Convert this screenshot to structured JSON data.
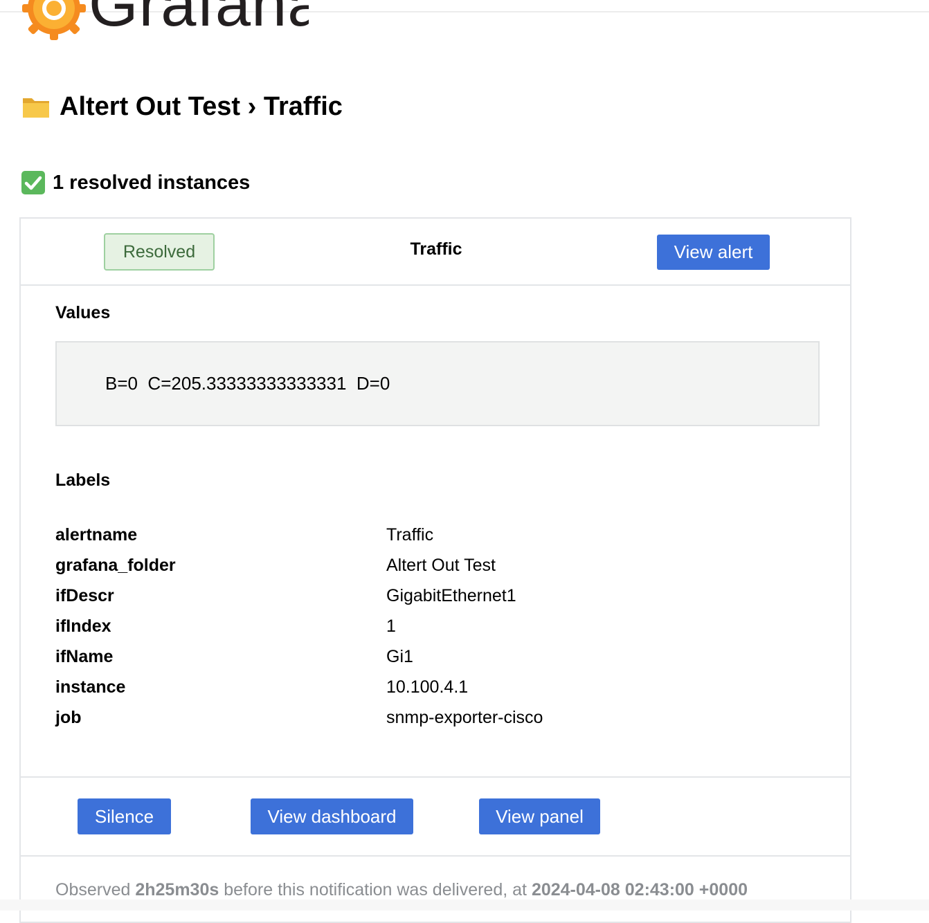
{
  "logo": {
    "text": "Grafana"
  },
  "header": {
    "folder": "Altert Out Test",
    "separator": "›",
    "rule": "Traffic",
    "title": "Altert Out Test › Traffic"
  },
  "summary": {
    "heading": "1 resolved instances"
  },
  "alert": {
    "status": "Resolved",
    "name": "Traffic",
    "view_alert_label": "View alert",
    "values_title": "Values",
    "values_text": "B=0  C=205.33333333333331  D=0",
    "labels_title": "Labels",
    "labels": [
      {
        "key": "alertname",
        "value": "Traffic"
      },
      {
        "key": "grafana_folder",
        "value": "Altert Out Test"
      },
      {
        "key": "ifDescr",
        "value": "GigabitEthernet1"
      },
      {
        "key": "ifIndex",
        "value": "1"
      },
      {
        "key": "ifName",
        "value": "Gi1"
      },
      {
        "key": "instance",
        "value": "10.100.4.1"
      },
      {
        "key": "job",
        "value": "snmp-exporter-cisco"
      }
    ],
    "actions": {
      "silence": "Silence",
      "view_dashboard": "View dashboard",
      "view_panel": "View panel"
    },
    "observed": {
      "prefix": "Observed",
      "duration": "2h25m30s",
      "middle": "before this notification was delivered, at",
      "timestamp": "2024-04-08 02:43:00 +0000"
    }
  },
  "colors": {
    "button_blue": "#3d71d9",
    "resolved_bg": "#e6f2e3",
    "resolved_border": "#9ed0a0",
    "resolved_text": "#3c6a3b",
    "logo_orange": "#f5a623"
  },
  "icons": {
    "folder": "folder-icon",
    "check": "check-mark-icon",
    "logo": "grafana-logo-icon"
  }
}
